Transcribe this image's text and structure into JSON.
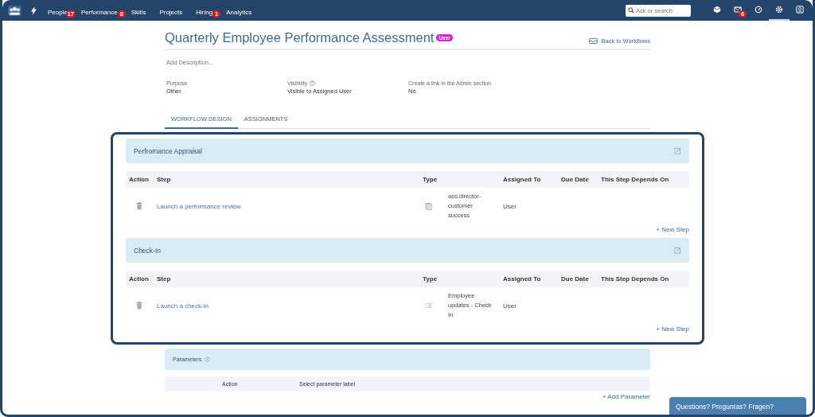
{
  "nav": {
    "items": [
      {
        "label": "People",
        "badge": "17"
      },
      {
        "label": "Performance",
        "badge": "8"
      },
      {
        "label": "Skills"
      },
      {
        "label": "Projects"
      },
      {
        "label": "Hiring",
        "badge": "1"
      },
      {
        "label": "Analytics"
      }
    ],
    "search": {
      "placeholder": "Ask or search"
    },
    "icons": [
      {
        "kind": "cube",
        "selected": false
      },
      {
        "kind": "mail",
        "selected": false,
        "badge": "6"
      },
      {
        "kind": "gauge",
        "selected": false
      },
      {
        "kind": "gear",
        "selected": true
      },
      {
        "kind": "user",
        "selected": false
      }
    ]
  },
  "title": "Quarterly Employee Performance Assessment",
  "title_badge": "User",
  "back_link": "Back to Workflows",
  "description_placeholder": "Add Description...",
  "fields": [
    {
      "label": "Purpose",
      "value": "Other",
      "help": false
    },
    {
      "label": "Visibility",
      "value": "Visible to Assigned User",
      "help": true
    },
    {
      "label": "Create a link in the Admin section",
      "value": "No",
      "help": false
    }
  ],
  "tabs": [
    {
      "label": "WORKFLOW DESIGN",
      "selected": true
    },
    {
      "label": "ASSIGNMENTS",
      "selected": false
    }
  ],
  "sections": [
    {
      "title": "Perfromance Appraisal",
      "columns": [
        "Action",
        "Step",
        "Type",
        "Assigned To",
        "Due Date",
        "This Step Depends On"
      ],
      "steps": [
        {
          "step": "Launch a performance review",
          "kind": "document",
          "type": "ass.director-customer success",
          "assigned_to": "User"
        }
      ],
      "add": "+ New Step"
    },
    {
      "title": "Check-In",
      "columns": [
        "Action",
        "Step",
        "Type",
        "Assigned To",
        "Due Date",
        "This Step Depends On"
      ],
      "steps": [
        {
          "step": "Launch a check-in",
          "kind": "checklist",
          "type": "Employee updates - Check In",
          "assigned_to": "User"
        }
      ],
      "add": "+ New Step"
    }
  ],
  "parameters": {
    "title": "Parameters",
    "columns": [
      "Action",
      "Select parameter label"
    ],
    "add": "+ Add Parameter"
  },
  "chat_button": "Questions? Preguntas? Fragen?"
}
